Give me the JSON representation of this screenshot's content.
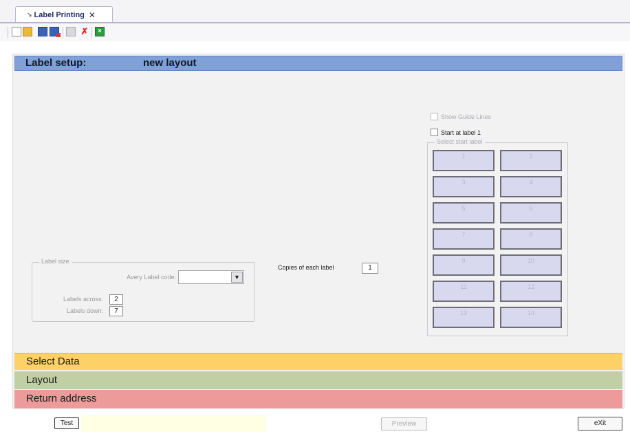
{
  "tab": {
    "title": "Label Printing",
    "close": "✕"
  },
  "header": {
    "title": "Label setup:",
    "layout_name": "new layout"
  },
  "label_size": {
    "legend": "Label size",
    "avery_label": "Avery Label code:",
    "avery_value": "",
    "labels_across_label": "Labels across:",
    "labels_across": "2",
    "labels_down_label": "Labels down:",
    "labels_down": "7"
  },
  "copies": {
    "label": "Copies of each label",
    "value": "1"
  },
  "options": {
    "show_guide_lines": "Show Guide Lines",
    "start_at_label_1": "Start at label 1"
  },
  "start_label": {
    "legend": "Select start label",
    "labels": [
      "1",
      "2",
      "3",
      "4",
      "5",
      "6",
      "7",
      "8",
      "9",
      "10",
      "11",
      "12",
      "13",
      "14"
    ]
  },
  "sections": {
    "select_data": "Select Data",
    "layout": "Layout",
    "return_address": "Return address"
  },
  "buttons": {
    "test": "Test",
    "preview": "Preview",
    "exit": "eXit"
  },
  "colors": {
    "header": "#7fa0d8",
    "select_data": "#fdd068",
    "layout": "#c0d0a4",
    "return_address": "#ec9a9a"
  }
}
